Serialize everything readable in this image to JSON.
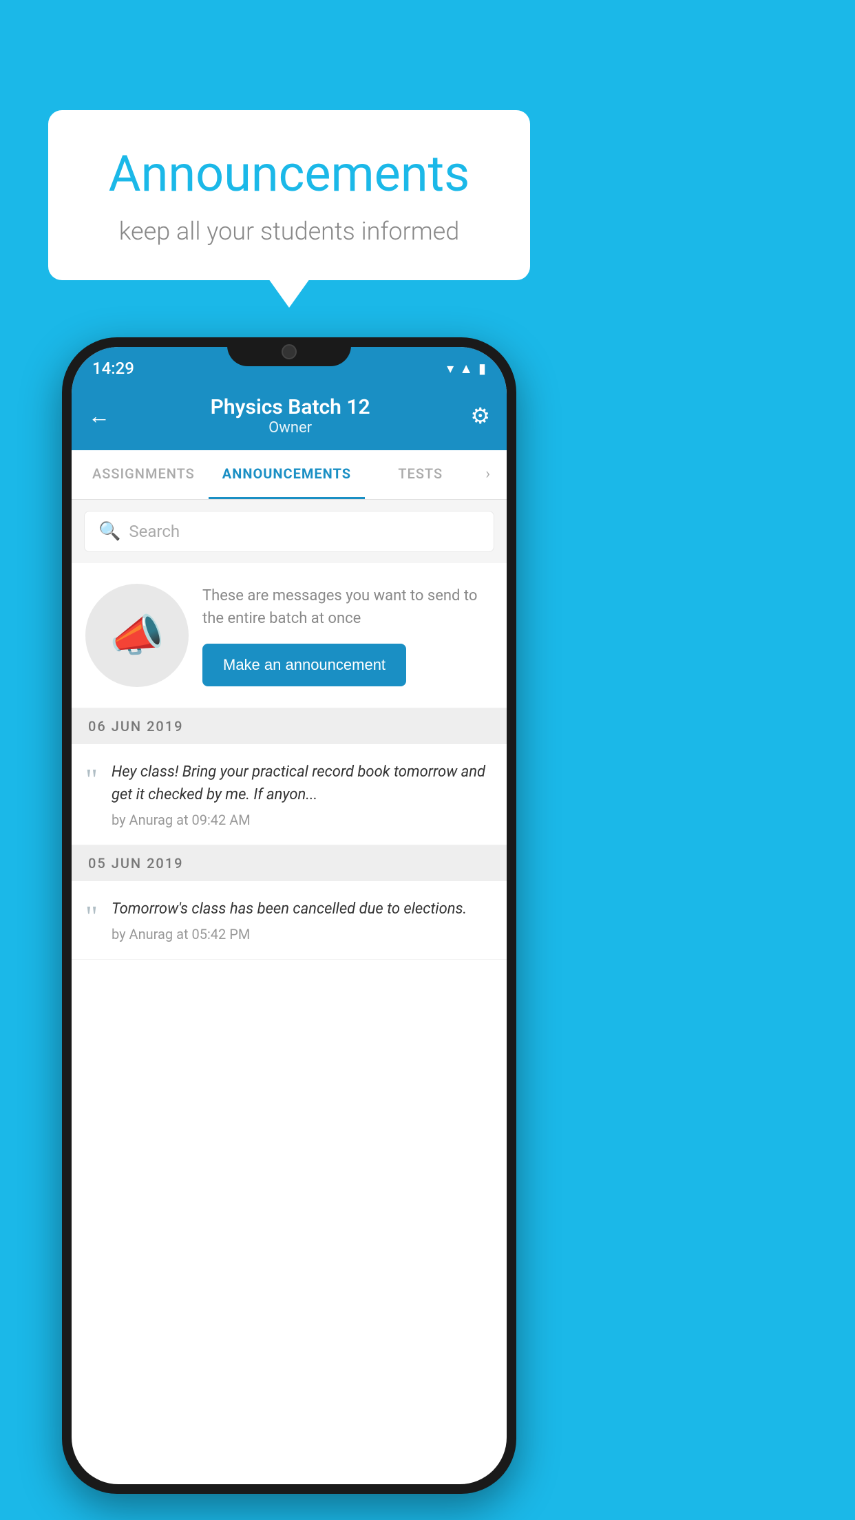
{
  "background_color": "#1BB8E8",
  "speech_bubble": {
    "title": "Announcements",
    "subtitle": "keep all your students informed"
  },
  "status_bar": {
    "time": "14:29",
    "icons": [
      "wifi",
      "signal",
      "battery"
    ]
  },
  "header": {
    "back_label": "←",
    "title": "Physics Batch 12",
    "subtitle": "Owner",
    "gear_label": "⚙"
  },
  "tabs": [
    {
      "label": "ASSIGNMENTS",
      "active": false
    },
    {
      "label": "ANNOUNCEMENTS",
      "active": true
    },
    {
      "label": "TESTS",
      "active": false
    }
  ],
  "search": {
    "placeholder": "Search"
  },
  "promo": {
    "description": "These are messages you want to send to the entire batch at once",
    "button_label": "Make an announcement"
  },
  "announcements": [
    {
      "date": "06  JUN  2019",
      "text": "Hey class! Bring your practical record book tomorrow and get it checked by me. If anyon...",
      "meta": "by Anurag at 09:42 AM"
    },
    {
      "date": "05  JUN  2019",
      "text": "Tomorrow's class has been cancelled due to elections.",
      "meta": "by Anurag at 05:42 PM"
    }
  ]
}
